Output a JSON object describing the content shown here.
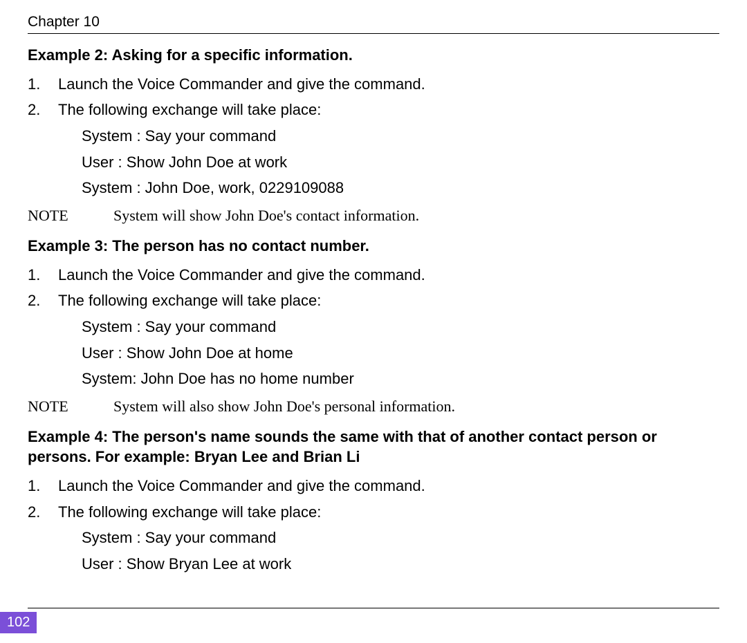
{
  "header": {
    "chapter": "Chapter 10"
  },
  "page_number": "102",
  "examples": [
    {
      "heading": "Example 2: Asking for a specific information.",
      "steps": [
        {
          "num": "1.",
          "text": "Launch the Voice Commander and give the command."
        },
        {
          "num": "2.",
          "text": "The following exchange will take place:"
        }
      ],
      "exchange": [
        "System :  Say your command",
        "User :  Show John Doe at work",
        "System :  John Doe, work, 0229109088"
      ],
      "note_label": "NOTE",
      "note_text": "System will show John Doe's contact information."
    },
    {
      "heading": "Example 3: The person has no contact number.",
      "steps": [
        {
          "num": "1.",
          "text": "Launch the Voice Commander and give the command."
        },
        {
          "num": "2.",
          "text": "The following exchange will take place:"
        }
      ],
      "exchange": [
        "System :  Say your command",
        "User :  Show John Doe at home",
        "System:  John Doe has no home number"
      ],
      "note_label": "NOTE",
      "note_text": "System will also show John Doe's personal information."
    },
    {
      "heading": "Example 4: The person's name sounds the same with that of another contact person or persons. For example: Bryan Lee and Brian Li",
      "steps": [
        {
          "num": "1.",
          "text": "Launch the Voice Commander and give the command."
        },
        {
          "num": "2.",
          "text": "The following exchange will take place:"
        }
      ],
      "exchange": [
        "System :  Say your command",
        "User :  Show Bryan Lee at work"
      ]
    }
  ]
}
